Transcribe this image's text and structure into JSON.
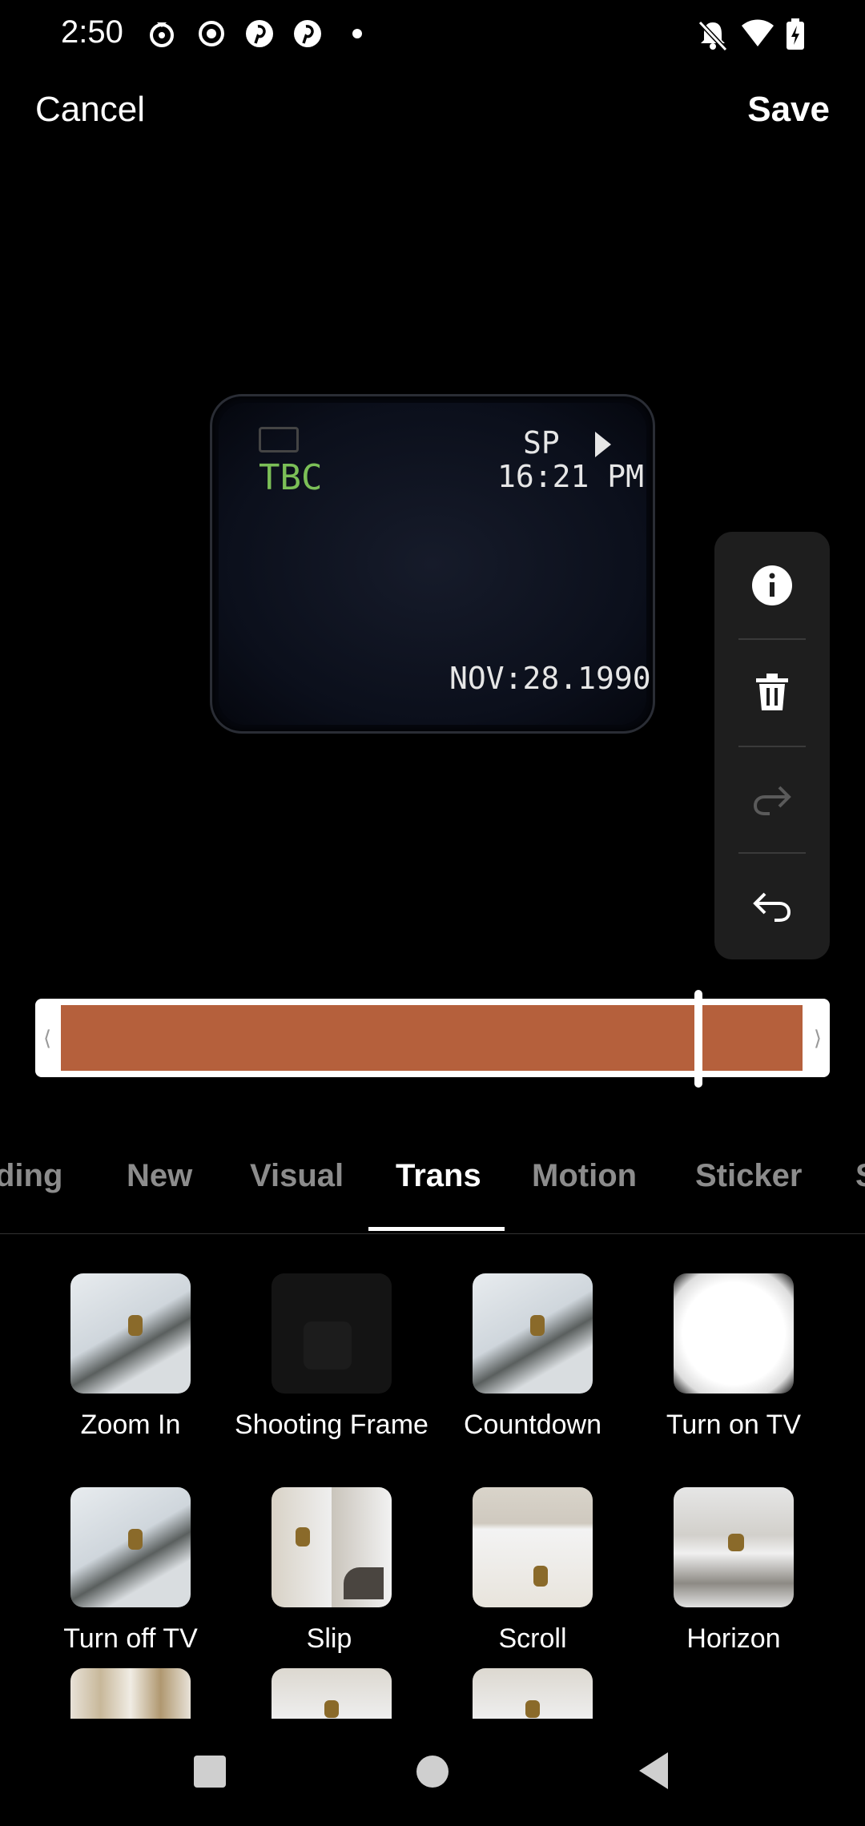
{
  "status_bar": {
    "time": "2:50"
  },
  "header": {
    "cancel_label": "Cancel",
    "save_label": "Save"
  },
  "preview": {
    "tbc": "TBC",
    "sp": "SP",
    "clock": "16:21 PM",
    "date": "NOV:28.1990"
  },
  "tools": {
    "icons": [
      "info-icon",
      "trash-icon",
      "redo-icon",
      "undo-icon"
    ]
  },
  "timeline": {
    "strip_color": "#b5603c",
    "playhead_fraction": 0.86
  },
  "tabs": [
    {
      "label": "ding",
      "active": false
    },
    {
      "label": "New",
      "active": false
    },
    {
      "label": "Visual",
      "active": false
    },
    {
      "label": "Trans",
      "active": true
    },
    {
      "label": "Motion",
      "active": false
    },
    {
      "label": "Sticker",
      "active": false
    },
    {
      "label": "S",
      "active": false
    }
  ],
  "effects": [
    {
      "label": "Zoom In"
    },
    {
      "label": "Shooting Frame"
    },
    {
      "label": "Countdown"
    },
    {
      "label": "Turn on TV"
    },
    {
      "label": "Turn off TV"
    },
    {
      "label": "Slip"
    },
    {
      "label": "Scroll"
    },
    {
      "label": "Horizon"
    }
  ],
  "colors": {
    "accent": "#ffffff",
    "inactive_tab": "#8c8c8c",
    "panel": "#1e1e1e"
  }
}
